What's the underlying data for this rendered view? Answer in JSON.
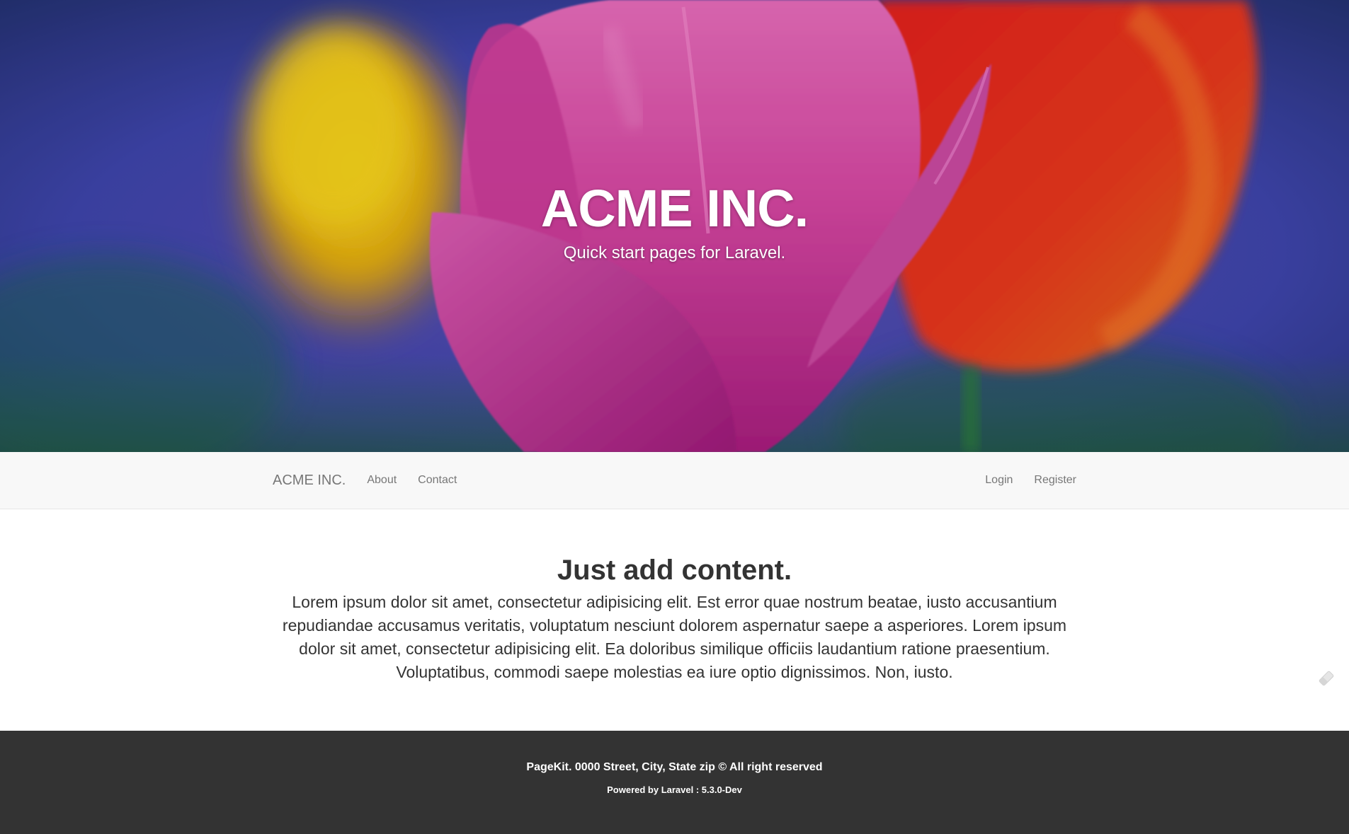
{
  "hero": {
    "title": "ACME INC.",
    "subtitle": "Quick start pages for Laravel."
  },
  "navbar": {
    "brand": "ACME INC.",
    "left_links": [
      "About",
      "Contact"
    ],
    "right_links": [
      "Login",
      "Register"
    ]
  },
  "main": {
    "heading": "Just add content.",
    "body": "Lorem ipsum dolor sit amet, consectetur adipisicing elit. Est error quae nostrum beatae, iusto accusantium repudiandae accusamus veritatis, voluptatum nesciunt dolorem aspernatur saepe a asperiores. Lorem ipsum dolor sit amet, consectetur adipisicing elit. Ea doloribus similique officiis laudantium ratione praesentium. Voluptatibus, commodi saepe molestias ea iure optio dignissimos. Non, iusto."
  },
  "footer": {
    "line1": "PageKit. 0000 Street, City, State zip © All right reserved",
    "line2": "Powered by Laravel : 5.3.0-Dev"
  },
  "icons": {
    "floating": "eraser-icon"
  },
  "colors": {
    "navbar_bg": "#f8f8f8",
    "nav_text": "#777777",
    "body_text": "#333333",
    "footer_bg": "#333333"
  }
}
